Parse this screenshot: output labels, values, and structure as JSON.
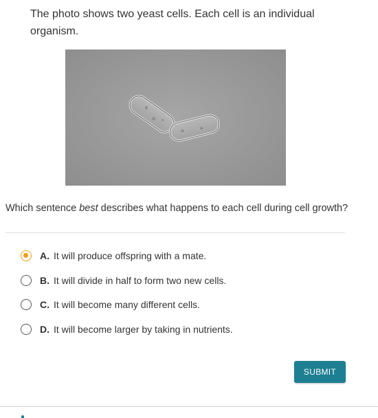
{
  "passage": {
    "text": "The photo shows two yeast cells. Each cell is an individual organism."
  },
  "question": {
    "prefix": "Which sentence ",
    "emphasis": "best",
    "suffix": " describes what happens to each cell during cell growth?"
  },
  "options": [
    {
      "letter": "A.",
      "text": "It will produce offspring with a mate.",
      "selected": true
    },
    {
      "letter": "B.",
      "text": "It will divide in half to form two new cells.",
      "selected": false
    },
    {
      "letter": "C.",
      "text": "It will become many different cells.",
      "selected": false
    },
    {
      "letter": "D.",
      "text": "It will become larger by taking in nutrients.",
      "selected": false
    }
  ],
  "submit": {
    "label": "SUBMIT"
  },
  "colors": {
    "accent_selected": "#f39c12",
    "submit_bg": "#1d7f92",
    "text": "#333333"
  }
}
